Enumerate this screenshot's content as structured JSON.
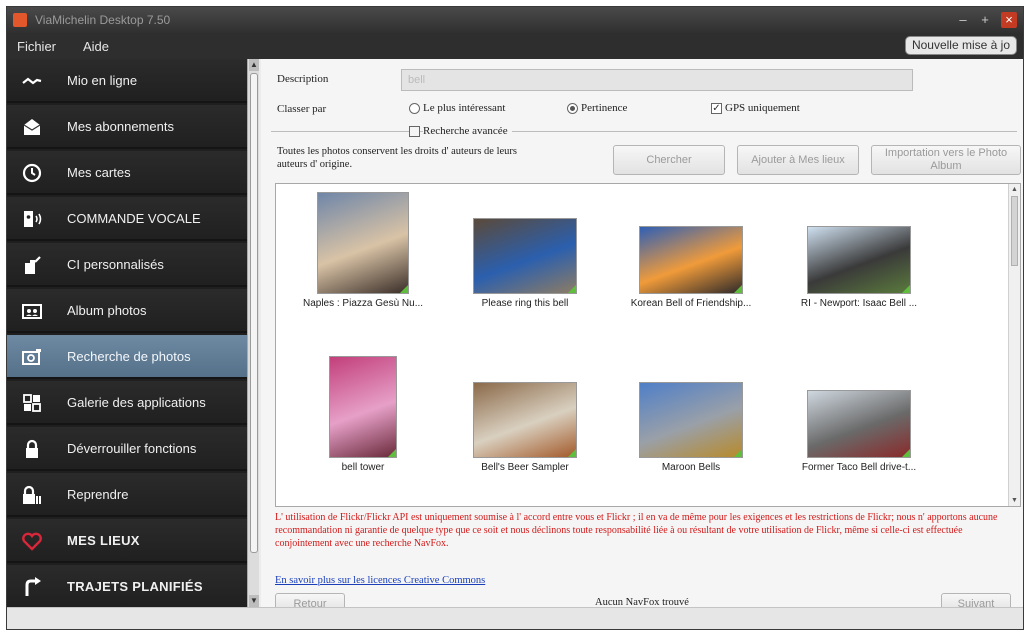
{
  "window": {
    "title": "ViaMichelin Desktop 7.50",
    "update_button": "Nouvelle mise à jo"
  },
  "menu": {
    "fichier": "Fichier",
    "aide": "Aide"
  },
  "sidebar": {
    "items": [
      {
        "label": "Mio en ligne",
        "icon": "wave-icon"
      },
      {
        "label": "Mes abonnements",
        "icon": "envelope-icon"
      },
      {
        "label": "Mes cartes",
        "icon": "compass-icon"
      },
      {
        "label": "COMMANDE VOCALE",
        "icon": "voice-icon"
      },
      {
        "label": "CI personnalisés",
        "icon": "custom-poi-icon"
      },
      {
        "label": "Album photos",
        "icon": "photo-album-icon"
      },
      {
        "label": "Recherche de photos",
        "icon": "camera-icon"
      },
      {
        "label": "Galerie des applications",
        "icon": "apps-grid-icon"
      },
      {
        "label": "Déverrouiller fonctions",
        "icon": "lock-icon"
      },
      {
        "label": "Reprendre",
        "icon": "lock-resume-icon"
      },
      {
        "label": "MES LIEUX",
        "icon": "heart-icon"
      },
      {
        "label": "TRAJETS PLANIFIÉS",
        "icon": "route-icon"
      }
    ],
    "active_index": 6
  },
  "search": {
    "description_label": "Description",
    "description_value": "bell",
    "sort_label": "Classer par",
    "options": {
      "most_interesting": "Le plus intéressant",
      "relevance": "Pertinence",
      "gps_only": "GPS uniquement",
      "exact_search": "Recherche avancée"
    },
    "cc_notice": "Toutes les photos conservent les droits d' auteurs de leurs auteurs d' origine.",
    "buttons": {
      "search": "Chercher",
      "add_to_places": "Ajouter à Mes lieux",
      "import_album": "Importation vers le Photo Album"
    }
  },
  "photos": [
    {
      "caption": "Naples : Piazza Gesù Nu...",
      "colors": [
        "#6f86a8",
        "#d9c3a6",
        "#3a2e28"
      ]
    },
    {
      "caption": "Please ring this bell",
      "colors": [
        "#5b4a3a",
        "#2b5fae",
        "#8d7c64"
      ]
    },
    {
      "caption": "Korean Bell of Friendship...",
      "colors": [
        "#2f5fb5",
        "#f09b3a",
        "#2e2a2a"
      ]
    },
    {
      "caption": "RI - Newport: Isaac Bell ...",
      "colors": [
        "#cfe0f0",
        "#3a3a3a",
        "#5a7a3c"
      ]
    },
    {
      "caption": "bell tower",
      "colors": [
        "#c23f7a",
        "#e6a0c8",
        "#6a2a3a"
      ]
    },
    {
      "caption": "Bell's Beer Sampler",
      "colors": [
        "#8b6a4a",
        "#d9d0c0",
        "#a35a2a"
      ]
    },
    {
      "caption": "Maroon Bells",
      "colors": [
        "#4f7fc8",
        "#9aa0a8",
        "#b88a2a"
      ]
    },
    {
      "caption": "Former Taco Bell drive-t...",
      "colors": [
        "#cfd8e0",
        "#6a6a6a",
        "#8a2a2a"
      ]
    }
  ],
  "footer": {
    "disclaimer": "L' utilisation de Flickr/Flickr API est uniquement soumise à l' accord entre vous et Flickr ; il en va de même pour les exigences et les restrictions de Flickr; nous n' apportons aucune recommandation ni garantie de quelque type que ce soit et nous déclinons toute responsabilité liée à ou résultant de votre utilisation de Flickr, même si celle-ci est effectuée conjointement avec une recherche NavFox.",
    "cc_link": "En savoir plus sur les licences Creative Commons",
    "back": "Retour",
    "status": "Aucun NavFox trouvé",
    "next": "Suivant"
  }
}
